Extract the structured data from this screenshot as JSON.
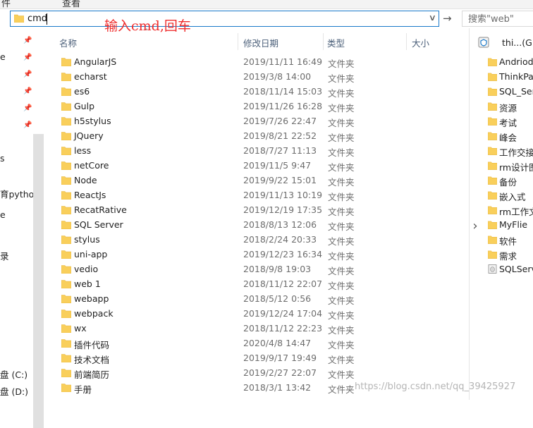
{
  "top_strip": {
    "left_fragment": "件",
    "mid_fragment": "查看"
  },
  "address_bar": {
    "value": "cmd"
  },
  "search": {
    "placeholder": "搜索\"web\""
  },
  "annotation": "输入cmd,回车",
  "nav": {
    "fragments": [
      "e",
      "s",
      "育python",
      "e",
      "录",
      "盘 (C:)",
      "盘 (D:)"
    ]
  },
  "columns": {
    "name": "名称",
    "date": "修改日期",
    "type": "类型",
    "size": "大小"
  },
  "files": [
    {
      "name": "AngularJS",
      "date": "2019/11/11 16:49",
      "type": "文件夹"
    },
    {
      "name": "echarst",
      "date": "2019/3/8 14:00",
      "type": "文件夹"
    },
    {
      "name": "es6",
      "date": "2018/11/14 15:03",
      "type": "文件夹"
    },
    {
      "name": "Gulp",
      "date": "2019/11/26 16:28",
      "type": "文件夹"
    },
    {
      "name": "h5stylus",
      "date": "2019/7/26 22:47",
      "type": "文件夹"
    },
    {
      "name": "JQuery",
      "date": "2019/8/21 22:52",
      "type": "文件夹"
    },
    {
      "name": "less",
      "date": "2018/7/27 11:13",
      "type": "文件夹"
    },
    {
      "name": "netCore",
      "date": "2019/11/5 9:47",
      "type": "文件夹"
    },
    {
      "name": "Node",
      "date": "2019/9/22 15:01",
      "type": "文件夹"
    },
    {
      "name": "ReactJs",
      "date": "2019/11/13 10:19",
      "type": "文件夹"
    },
    {
      "name": "RecatRative",
      "date": "2019/12/19 17:35",
      "type": "文件夹"
    },
    {
      "name": "SQL Server",
      "date": "2018/8/13 12:06",
      "type": "文件夹"
    },
    {
      "name": "stylus",
      "date": "2018/2/24 20:33",
      "type": "文件夹"
    },
    {
      "name": "uni-app",
      "date": "2019/12/23 16:34",
      "type": "文件夹"
    },
    {
      "name": "vedio",
      "date": "2018/9/8 19:03",
      "type": "文件夹"
    },
    {
      "name": "web 1",
      "date": "2018/11/12 22:07",
      "type": "文件夹"
    },
    {
      "name": "webapp",
      "date": "2018/5/12 0:56",
      "type": "文件夹"
    },
    {
      "name": "webpack",
      "date": "2019/12/24 17:04",
      "type": "文件夹"
    },
    {
      "name": "wx",
      "date": "2018/11/12 22:23",
      "type": "文件夹"
    },
    {
      "name": "插件代码",
      "date": "2020/4/8 14:47",
      "type": "文件夹"
    },
    {
      "name": "技术文档",
      "date": "2019/9/17 19:49",
      "type": "文件夹"
    },
    {
      "name": "前端简历",
      "date": "2019/2/27 22:07",
      "type": "文件夹"
    },
    {
      "name": "手册",
      "date": "2018/3/1 13:42",
      "type": "文件夹"
    }
  ],
  "drive": {
    "label": "thi...(G:)"
  },
  "right_items": [
    {
      "name": "Andriod",
      "kind": "folder"
    },
    {
      "name": "ThinkPac",
      "kind": "folder"
    },
    {
      "name": "SQL_Ser",
      "kind": "folder"
    },
    {
      "name": "资源",
      "kind": "folder"
    },
    {
      "name": "考试",
      "kind": "folder"
    },
    {
      "name": "峰会",
      "kind": "folder"
    },
    {
      "name": "工作交接",
      "kind": "folder"
    },
    {
      "name": "rm设计图",
      "kind": "folder"
    },
    {
      "name": "备份",
      "kind": "folder"
    },
    {
      "name": "嵌入式",
      "kind": "folder"
    },
    {
      "name": "rm工作文",
      "kind": "folder"
    },
    {
      "name": "MyFlie",
      "kind": "folder"
    },
    {
      "name": "软件",
      "kind": "folder"
    },
    {
      "name": "需求",
      "kind": "folder"
    },
    {
      "name": "SQLServ",
      "kind": "file"
    }
  ],
  "watermark": "https://blog.csdn.net/qq_39425927",
  "colors": {
    "folder": "#f9cf5b",
    "folder_dark": "#e6b43a",
    "accent": "#1979ca",
    "annotation": "#ef2d2d"
  }
}
